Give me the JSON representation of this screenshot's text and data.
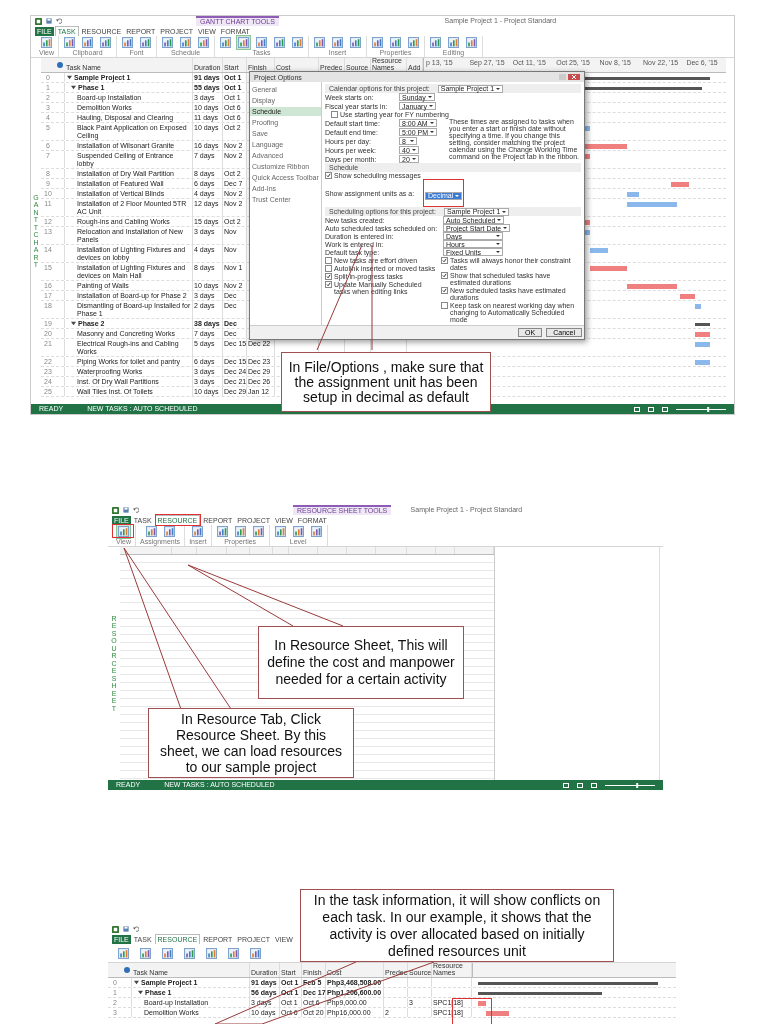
{
  "gantt_screen": {
    "title": "Sample Project 1 - Project Standard",
    "context_tab": "GANTT CHART TOOLS",
    "tabs": [
      {
        "label": "FILE",
        "selected": false
      },
      {
        "label": "TASK",
        "selected": true
      },
      {
        "label": "RESOURCE",
        "selected": false
      },
      {
        "label": "REPORT",
        "selected": false
      },
      {
        "label": "PROJECT",
        "selected": false
      },
      {
        "label": "VIEW",
        "selected": false
      },
      {
        "label": "FORMAT",
        "selected": false
      }
    ],
    "ribbon": [
      {
        "group": "View",
        "buttons": [
          {
            "selected": false
          }
        ]
      },
      {
        "group": "Clipboard",
        "buttons": [
          {
            "selected": false
          },
          {
            "selected": false
          },
          {
            "selected": false
          }
        ]
      },
      {
        "group": "Font",
        "buttons": [
          {
            "selected": false
          },
          {
            "selected": false
          }
        ]
      },
      {
        "group": "Schedule",
        "buttons": [
          {
            "selected": false
          },
          {
            "selected": false
          },
          {
            "selected": false
          }
        ]
      },
      {
        "group": "Tasks",
        "buttons": [
          {
            "selected": false
          },
          {
            "selected": true
          },
          {
            "selected": false
          },
          {
            "selected": false
          },
          {
            "selected": false
          }
        ]
      },
      {
        "group": "Insert",
        "buttons": [
          {
            "selected": false
          },
          {
            "selected": false
          },
          {
            "selected": false
          }
        ]
      },
      {
        "group": "Properties",
        "buttons": [
          {
            "selected": false
          },
          {
            "selected": false
          },
          {
            "selected": false
          }
        ]
      },
      {
        "group": "Editing",
        "buttons": [
          {
            "selected": false
          },
          {
            "selected": false
          },
          {
            "selected": false
          }
        ]
      }
    ],
    "side_label": "GANTT CHART",
    "columns": [
      "Task Name",
      "Duration",
      "Start",
      "Finish",
      "Cost",
      "Predec",
      "Source",
      "Resource Names",
      "Add"
    ],
    "timescale": [
      "p 13, '15",
      "Sep 27, '15",
      "Oct 11, '15",
      "Oct 25, '15",
      "Nov 8, '15",
      "Nov 22, '15",
      "Dec 6, '15"
    ],
    "rows": [
      {
        "id": "0",
        "kind": "summary",
        "expanded": true,
        "name": "Sample Project 1",
        "duration": "91 days",
        "start": "Oct 1"
      },
      {
        "id": "1",
        "kind": "summary",
        "expanded": true,
        "name": "Phase 1",
        "duration": "55 days",
        "start": "Oct 1"
      },
      {
        "id": "2",
        "kind": "task",
        "name": "Board-up Installation",
        "duration": "3 days",
        "start": "Oct 1"
      },
      {
        "id": "3",
        "kind": "task",
        "name": "Demolition Works",
        "duration": "10 days",
        "start": "Oct 6"
      },
      {
        "id": "4",
        "kind": "task",
        "name": "Hauling, Disposal and Clearing",
        "duration": "11 days",
        "start": "Oct 6"
      },
      {
        "id": "5",
        "kind": "task",
        "name": "Black Paint Application on Exposed Ceiling",
        "duration": "10 days",
        "start": "Oct 2",
        "critical": false
      },
      {
        "id": "6",
        "kind": "task",
        "name": "Installation of Wilsonart Granite",
        "duration": "16 days",
        "start": "Nov 2",
        "critical": true
      },
      {
        "id": "7",
        "kind": "task",
        "name": "Suspended Ceiling of Entrance lobby",
        "duration": "7 days",
        "start": "Nov 2",
        "critical": true
      },
      {
        "id": "8",
        "kind": "task",
        "name": "Installation of Dry Wall Partition",
        "duration": "8 days",
        "start": "Oct 2"
      },
      {
        "id": "9",
        "kind": "task",
        "name": "Installation of Featured Wall",
        "duration": "6 days",
        "start": "Dec 7",
        "critical": true
      },
      {
        "id": "10",
        "kind": "task",
        "name": "Installation of Vertical Blinds",
        "duration": "4 days",
        "start": "Nov 2",
        "critical": false
      },
      {
        "id": "11",
        "kind": "task",
        "name": "Installation of 2 Floor Mounted 5TR AC Unit",
        "duration": "12 days",
        "start": "Nov 2",
        "critical": false
      },
      {
        "id": "12",
        "kind": "task",
        "name": "Rough-ins and Cabling Works",
        "duration": "15 days",
        "start": "Oct 2",
        "critical": true
      },
      {
        "id": "13",
        "kind": "task",
        "name": "Relocation and Installation of New Panels",
        "duration": "3 days",
        "start": "Nov",
        "critical": false
      },
      {
        "id": "14",
        "kind": "task",
        "name": "Installation of Lighting Fixtures and devices on lobby",
        "duration": "4 days",
        "start": "Nov",
        "critical": false
      },
      {
        "id": "15",
        "kind": "task",
        "name": "Installation of Lighting Fixtures and devices on Main Hall",
        "duration": "8 days",
        "start": "Nov 1",
        "critical": true
      },
      {
        "id": "16",
        "kind": "task",
        "name": "Painting of Walls",
        "duration": "10 days",
        "start": "Nov 2",
        "critical": true
      },
      {
        "id": "17",
        "kind": "task",
        "name": "Installation of Board-up for Phase 2",
        "duration": "3 days",
        "start": "Dec",
        "critical": true
      },
      {
        "id": "18",
        "kind": "task",
        "name": "Dismantling of Board-up Installed for Phase 1",
        "duration": "2 days",
        "start": "Dec",
        "critical": false
      },
      {
        "id": "19",
        "kind": "summary",
        "expanded": true,
        "name": "Phase 2",
        "duration": "38 days",
        "start": "Dec"
      },
      {
        "id": "20",
        "kind": "task",
        "name": "Masonry and Concreting Works",
        "duration": "7 days",
        "start": "Dec",
        "critical": true
      },
      {
        "id": "21",
        "kind": "task",
        "name": "Electrical Rough-ins and Cabling Works",
        "duration": "5 days",
        "start": "Dec 15",
        "finish": "Dec 22",
        "critical": false
      },
      {
        "id": "22",
        "kind": "task",
        "name": "Piping Works for toilet and pantry",
        "duration": "6 days",
        "start": "Dec 15",
        "finish": "Dec 23",
        "critical": false
      },
      {
        "id": "23",
        "kind": "task",
        "name": "Waterproofing Works",
        "duration": "3 days",
        "start": "Dec 24",
        "finish": "Dec 29"
      },
      {
        "id": "24",
        "kind": "task",
        "name": "Inst. Of Dry Wall Partitions",
        "duration": "3 days",
        "start": "Dec 21",
        "finish": "Dec 26"
      },
      {
        "id": "25",
        "kind": "task",
        "name": "Wall Tiles Inst. Of Toilets",
        "duration": "10 days",
        "start": "Dec 29",
        "finish": "Jan 12"
      }
    ],
    "dialog": {
      "title": "Project Options",
      "nav": [
        {
          "label": "General",
          "selected": false
        },
        {
          "label": "Display",
          "selected": false
        },
        {
          "label": "Schedule",
          "selected": true
        },
        {
          "label": "Proofing",
          "selected": false
        },
        {
          "label": "Save",
          "selected": false
        },
        {
          "label": "Language",
          "selected": false
        },
        {
          "label": "Advanced",
          "selected": false
        },
        {
          "label": "Customize Ribbon",
          "selected": false
        },
        {
          "label": "Quick Access Toolbar",
          "selected": false
        },
        {
          "label": "Add-Ins",
          "selected": false
        },
        {
          "label": "Trust Center",
          "selected": false
        }
      ],
      "calendar_heading": "Calendar options for this project:",
      "calendar_project": "Sample Project 1",
      "calendar_fields": [
        {
          "label": "Week starts on:",
          "value": "Sunday"
        },
        {
          "label": "Fiscal year starts in:",
          "value": "January"
        }
      ],
      "fy_checkbox": {
        "label": "Use starting year for FY numbering",
        "checked": false
      },
      "time_fields": [
        {
          "label": "Default start time:",
          "value": "8:00 AM"
        },
        {
          "label": "Default end time:",
          "value": "5:00 PM"
        },
        {
          "label": "Hours per day:",
          "value": "8"
        },
        {
          "label": "Hours per week:",
          "value": "40"
        },
        {
          "label": "Days per month:",
          "value": "20"
        }
      ],
      "time_note": "These times are assigned to tasks when you enter a start or finish date without specifying a time. If you change this setting, consider matching the project calendar using the Change Working Time command on the Project tab in the ribbon.",
      "schedule_heading": "Schedule",
      "messages_checkbox": {
        "label": "Show scheduling messages",
        "checked": true
      },
      "units_label": "Show assignment units as a:",
      "units_value": "Decimal",
      "scheduling_heading": "Scheduling options for this project:",
      "scheduling_project": "Sample Project 1",
      "scheduling_fields": [
        {
          "label": "New tasks created:",
          "value": "Auto Scheduled"
        },
        {
          "label": "Auto scheduled tasks scheduled on:",
          "value": "Project Start Date"
        },
        {
          "label": "Duration is entered in:",
          "value": "Days"
        },
        {
          "label": "Work is entered in:",
          "value": "Hours"
        },
        {
          "label": "Default task type:",
          "value": "Fixed Units"
        }
      ],
      "options_left": [
        {
          "label": "New tasks are effort driven",
          "checked": false
        },
        {
          "label": "Autolink inserted or moved tasks",
          "checked": false
        },
        {
          "label": "Split in-progress tasks",
          "checked": true
        },
        {
          "label": "Update Manually Scheduled tasks when editing links",
          "checked": true
        }
      ],
      "options_right": [
        {
          "label": "Tasks will always honor their constraint dates",
          "checked": true
        },
        {
          "label": "Show that scheduled tasks have estimated durations",
          "checked": true
        },
        {
          "label": "New scheduled tasks have estimated durations",
          "checked": true
        },
        {
          "label": "Keep task on nearest working day when changing to Automatically Scheduled mode",
          "checked": false
        }
      ],
      "buttons": [
        "OK",
        "Cancel"
      ]
    },
    "status": [
      "READY",
      "NEW TASKS : AUTO SCHEDULED"
    ],
    "zoom": {
      "level": 0.65
    }
  },
  "resource_screen": {
    "title": "Sample Project 1 - Project Standard",
    "context_tab": "RESOURCE SHEET TOOLS",
    "tabs": [
      {
        "label": "FILE",
        "selected": false
      },
      {
        "label": "TASK",
        "selected": false
      },
      {
        "label": "RESOURCE",
        "selected": true
      },
      {
        "label": "REPORT",
        "selected": false
      },
      {
        "label": "PROJECT",
        "selected": false
      },
      {
        "label": "VIEW",
        "selected": false
      },
      {
        "label": "FORMAT",
        "selected": false
      }
    ],
    "ribbon": [
      {
        "group": "View",
        "buttons": [
          {
            "selected": true
          }
        ]
      },
      {
        "group": "Assignments",
        "buttons": [
          {
            "selected": false
          },
          {
            "selected": false
          }
        ]
      },
      {
        "group": "Insert",
        "buttons": [
          {
            "selected": false
          }
        ]
      },
      {
        "group": "Properties",
        "buttons": [
          {
            "selected": false
          },
          {
            "selected": false
          },
          {
            "selected": false
          }
        ]
      },
      {
        "group": "Level",
        "buttons": [
          {
            "selected": false
          },
          {
            "selected": false
          },
          {
            "selected": false
          }
        ]
      }
    ],
    "side_label": "RESOURCE SHEET",
    "status": [
      "READY",
      "NEW TASKS : AUTO SCHEDULED"
    ],
    "zoom": {
      "level": 0.65
    }
  },
  "task_screen": {
    "tabs": [
      {
        "label": "FILE",
        "selected": false
      },
      {
        "label": "TASK",
        "selected": false
      },
      {
        "label": "RESOURCE",
        "selected": true
      },
      {
        "label": "REPORT",
        "selected": false
      },
      {
        "label": "PROJECT",
        "selected": false
      },
      {
        "label": "VIEW",
        "selected": false
      }
    ],
    "ribbon_buttons": [
      {
        "selected": false
      },
      {
        "selected": false
      },
      {
        "selected": false
      },
      {
        "selected": false
      },
      {
        "selected": false
      },
      {
        "selected": false
      },
      {
        "selected": false
      }
    ],
    "columns": [
      "Task Name",
      "Duration",
      "Start",
      "Finish",
      "Cost",
      "Predec",
      "Source",
      "Resource Names"
    ],
    "rows": [
      {
        "id": "0",
        "kind": "summary",
        "expanded": true,
        "name": "Sample Project 1",
        "duration": "91 days",
        "start": "Oct 1",
        "finish": "Feb 5",
        "cost": "Php3,468,508.00"
      },
      {
        "id": "1",
        "kind": "summary",
        "expanded": true,
        "name": "Phase 1",
        "duration": "56 days",
        "start": "Oct 1",
        "finish": "Dec 17",
        "cost": "Php1,206,600.00"
      },
      {
        "id": "2",
        "kind": "task",
        "name": "Board-up Installation",
        "duration": "3 days",
        "start": "Oct 1",
        "finish": "Oct 6",
        "cost": "Php9,000.00",
        "source": "3",
        "resource": "SPC1[18]",
        "critical": true
      },
      {
        "id": "3",
        "kind": "task",
        "name": "Demolition Works",
        "duration": "10 days",
        "start": "Oct 6",
        "finish": "Oct 20",
        "cost": "Php16,000.00",
        "predecessors": "2",
        "resource": "SPC1[18]",
        "critical": true
      }
    ]
  },
  "callouts": [
    {
      "text": "In File/Options , make sure that the assignment unit has been setup in decimal as default"
    },
    {
      "text": "In Resource Sheet, This will define the cost and manpower needed for a certain activity"
    },
    {
      "text": "In Resource Tab, Click Resource Sheet. By this sheet, we can load resources to our sample project"
    },
    {
      "text": "In the task information, it will show conflicts on each task. In our example, it shows that the activity is over allocated based on initially defined resources unit"
    }
  ]
}
